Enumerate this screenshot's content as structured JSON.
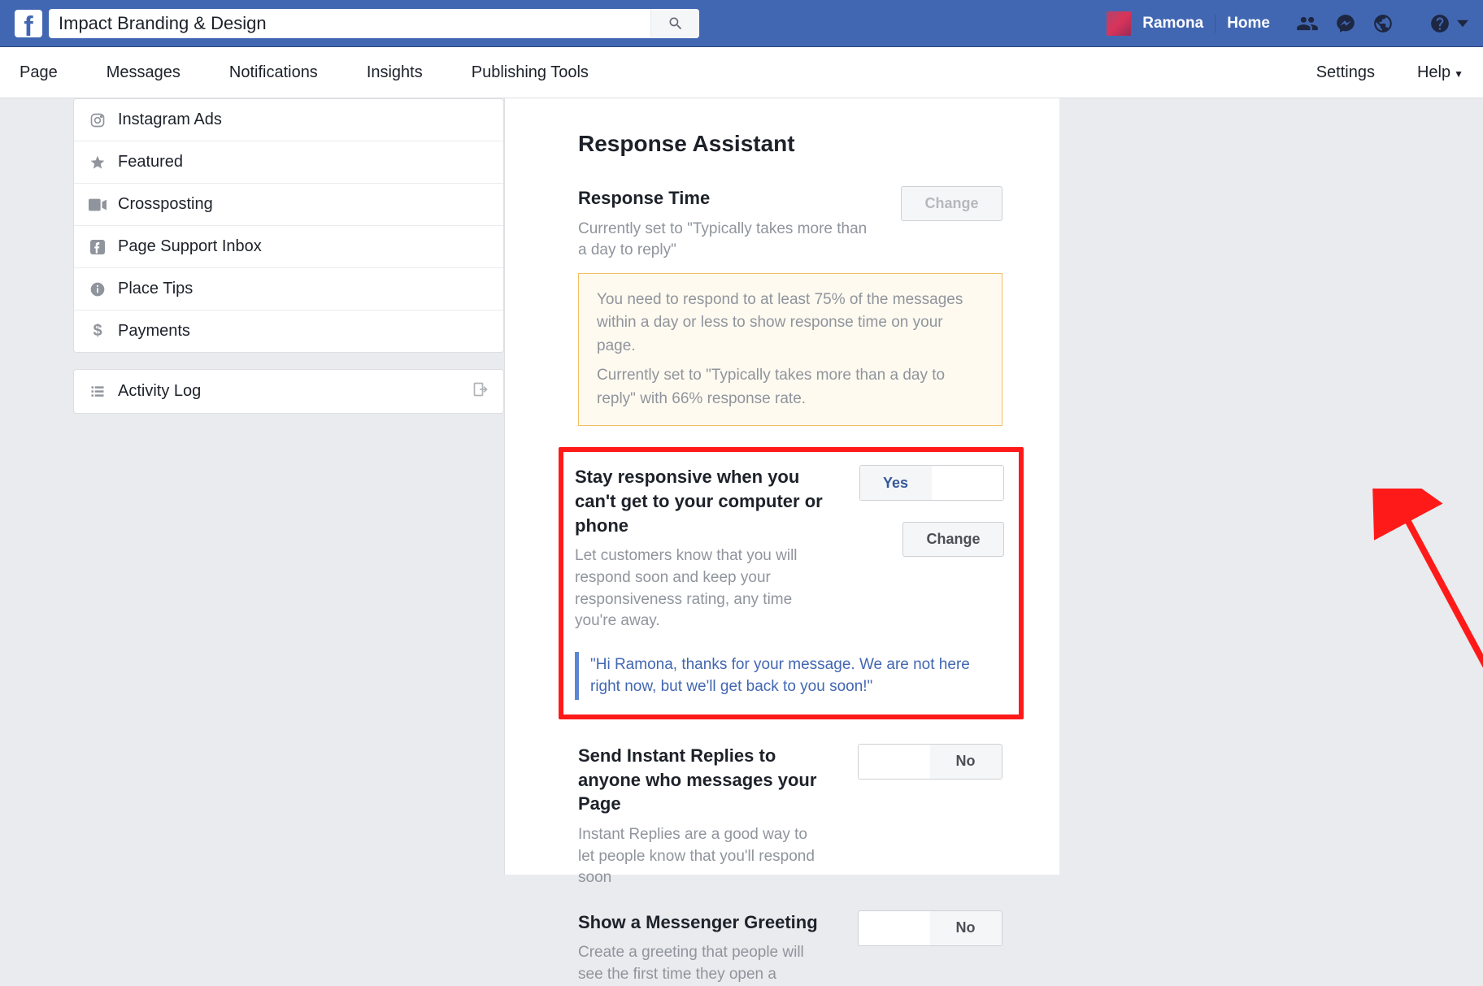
{
  "topbar": {
    "search_value": "Impact Branding & Design",
    "user_name": "Ramona",
    "home_label": "Home"
  },
  "secnav": {
    "page": "Page",
    "messages": "Messages",
    "notifications": "Notifications",
    "insights": "Insights",
    "publishing": "Publishing Tools",
    "settings": "Settings",
    "help": "Help"
  },
  "sidebar": {
    "items": [
      {
        "label": "Instagram Ads"
      },
      {
        "label": "Featured"
      },
      {
        "label": "Crossposting"
      },
      {
        "label": "Page Support Inbox"
      },
      {
        "label": "Place Tips"
      },
      {
        "label": "Payments"
      }
    ],
    "activity_log": "Activity Log"
  },
  "main": {
    "title": "Response Assistant",
    "response_time": {
      "title": "Response Time",
      "desc": "Currently set to \"Typically takes more than a day to reply\"",
      "change": "Change",
      "notice_line1": "You need to respond to at least 75% of the messages within a day or less to show response time on your page.",
      "notice_line2": "Currently set to \"Typically takes more than a day to reply\" with 66% response rate."
    },
    "stay_responsive": {
      "title": "Stay responsive when you can't get to your computer or phone",
      "desc": "Let customers know that you will respond soon and keep your responsiveness rating, any time you're away.",
      "toggle_yes": "Yes",
      "change": "Change",
      "quote": "\"Hi Ramona, thanks for your message. We are not here right now, but we'll get back to you soon!\""
    },
    "instant_replies": {
      "title": "Send Instant Replies to anyone who messages your Page",
      "desc": "Instant Replies are a good way to let people know that you'll respond soon",
      "toggle_no": "No"
    },
    "greeting": {
      "title": "Show a Messenger Greeting",
      "desc": "Create a greeting that people will see the first time they open a",
      "toggle_no": "No"
    }
  }
}
